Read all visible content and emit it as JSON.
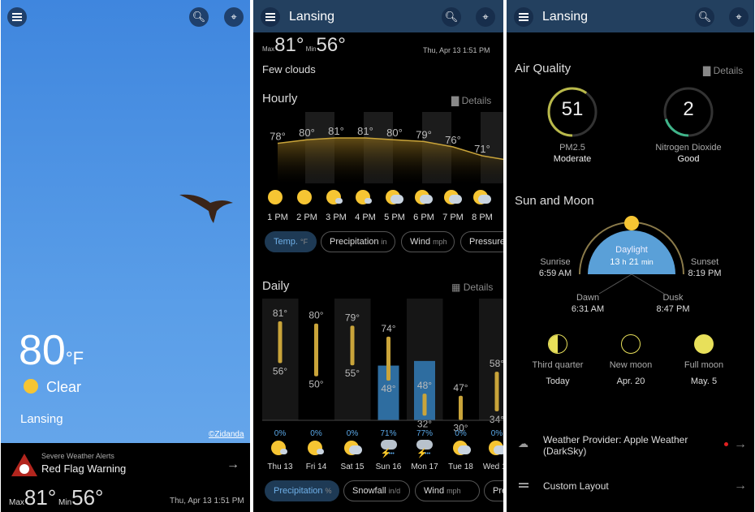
{
  "panel1": {
    "temp": "80",
    "unit": "°F",
    "condition": "Clear",
    "city": "Lansing",
    "credit": "©Zidanda",
    "alert_title": "Severe Weather Alerts",
    "alert_name": "Red Flag Warning",
    "max_label": "Max",
    "max": "81°",
    "min_label": "Min",
    "min": "56°",
    "datetime": "Thu, Apr 13 1:51 PM"
  },
  "panel2": {
    "city": "Lansing",
    "max_label": "Max",
    "max": "81°",
    "min_label": "Min",
    "min": "56°",
    "datetime": "Thu, Apr 13 1:51 PM",
    "condition": "Few clouds",
    "hourly_title": "Hourly",
    "details": "Details",
    "hourly": [
      {
        "t": "1 PM",
        "temp": "78°",
        "v": 78,
        "icon": "sun"
      },
      {
        "t": "2 PM",
        "temp": "80°",
        "v": 80,
        "icon": "sun"
      },
      {
        "t": "3 PM",
        "temp": "81°",
        "v": 81,
        "icon": "sun-cloud"
      },
      {
        "t": "4 PM",
        "temp": "81°",
        "v": 81,
        "icon": "sun-cloud"
      },
      {
        "t": "5 PM",
        "temp": "80°",
        "v": 80,
        "icon": "partly-cloudy"
      },
      {
        "t": "6 PM",
        "temp": "79°",
        "v": 79,
        "icon": "partly-cloudy"
      },
      {
        "t": "7 PM",
        "temp": "76°",
        "v": 76,
        "icon": "partly-cloudy"
      },
      {
        "t": "8 PM",
        "temp": "71°",
        "v": 71,
        "icon": "partly-cloudy"
      }
    ],
    "hourly_tabs": [
      {
        "label": "Temp.",
        "unit": "°F"
      },
      {
        "label": "Precipitation",
        "unit": "in"
      },
      {
        "label": "Wind",
        "unit": "mph"
      },
      {
        "label": "Pressure",
        "unit": ""
      }
    ],
    "daily_title": "Daily",
    "daily": [
      {
        "d": "Thu 13",
        "hi": "81°",
        "lo": "56°",
        "h": 81,
        "l": 56,
        "p": "0%",
        "pv": 0,
        "icon": "sun-cloud"
      },
      {
        "d": "Fri 14",
        "hi": "80°",
        "lo": "50°",
        "h": 80,
        "l": 50,
        "p": "0%",
        "pv": 0,
        "icon": "sun-cloud"
      },
      {
        "d": "Sat 15",
        "hi": "79°",
        "lo": "55°",
        "h": 79,
        "l": 55,
        "p": "0%",
        "pv": 0,
        "icon": "partly-cloudy"
      },
      {
        "d": "Sun 16",
        "hi": "74°",
        "lo": "48°",
        "h": 74,
        "l": 48,
        "p": "71%",
        "pv": 71,
        "icon": "thunderstorm"
      },
      {
        "d": "Mon 17",
        "hi": "48°",
        "lo": "32°",
        "h": 48,
        "l": 32,
        "p": "77%",
        "pv": 77,
        "icon": "thunderstorm"
      },
      {
        "d": "Tue 18",
        "hi": "47°",
        "lo": "30°",
        "h": 47,
        "l": 30,
        "p": "0%",
        "pv": 0,
        "icon": "partly-cloudy"
      },
      {
        "d": "Wed 19",
        "hi": "58°",
        "lo": "34°",
        "h": 58,
        "l": 34,
        "p": "0%",
        "pv": 0,
        "icon": "partly-cloudy"
      }
    ],
    "daily_tabs": [
      {
        "label": "Precipitation",
        "unit": "%"
      },
      {
        "label": "Snowfall",
        "unit": "in/d"
      },
      {
        "label": "Wind",
        "unit": "mph"
      },
      {
        "label": "Pressure",
        "unit": ""
      }
    ]
  },
  "panel3": {
    "city": "Lansing",
    "aq_title": "Air Quality",
    "details": "Details",
    "aq": [
      {
        "value": "51",
        "name": "PM2.5",
        "level": "Moderate",
        "color": "#b9b94a",
        "frac": 0.6
      },
      {
        "value": "2",
        "name": "Nitrogen Dioxide",
        "level": "Good",
        "color": "#3fb58a",
        "frac": 0.2
      }
    ],
    "sm_title": "Sun and Moon",
    "daylight_label": "Daylight",
    "daylight_h": "13",
    "h": "h",
    "daylight_m": "21",
    "m": "min",
    "sunrise_label": "Sunrise",
    "sunrise": "6:59 AM",
    "sunset_label": "Sunset",
    "sunset": "8:19 PM",
    "dawn_label": "Dawn",
    "dawn": "6:31 AM",
    "dusk_label": "Dusk",
    "dusk": "8:47 PM",
    "moons": [
      {
        "phase": "Third quarter",
        "date": "Today"
      },
      {
        "phase": "New moon",
        "date": "Apr. 20"
      },
      {
        "phase": "Full moon",
        "date": "May. 5"
      }
    ],
    "provider": "Weather Provider: Apple Weather (DarkSky)",
    "custom_layout": "Custom Layout"
  },
  "colors": {
    "accent": "#6fb0e8",
    "header": "#23405f",
    "temp_bar": "#c9a43a",
    "alert": "#b3261e"
  }
}
